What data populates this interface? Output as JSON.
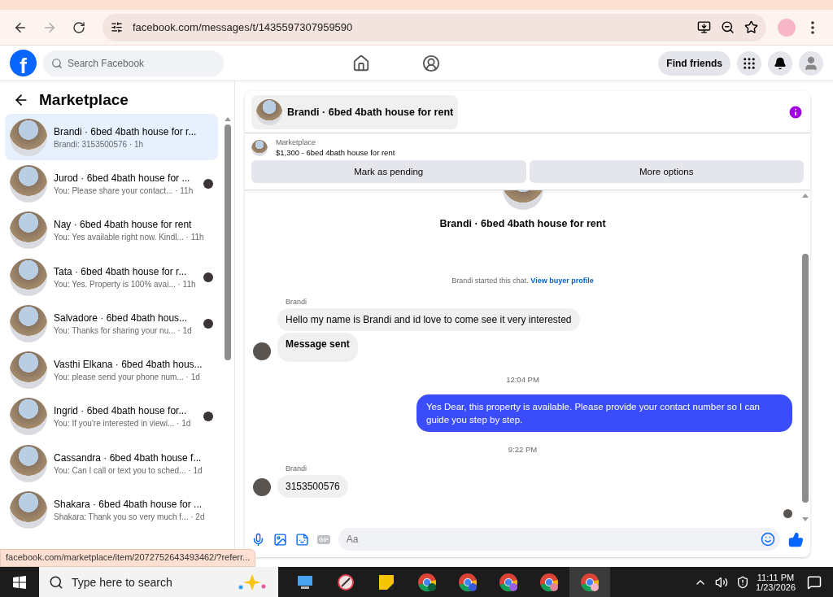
{
  "browser": {
    "url": "facebook.com/messages/t/1435597307959590"
  },
  "header": {
    "logo": "f",
    "search_placeholder": "Search Facebook",
    "find_friends": "Find friends"
  },
  "sidebar": {
    "title": "Marketplace",
    "conversations": [
      {
        "title": "Brandi · 6bed 4bath house for r...",
        "preview": "Brandi: 3153500576 · 1h",
        "selected": true,
        "seen_avatar": false
      },
      {
        "title": "Jurod · 6bed 4bath house for ...",
        "preview": "You: Please share your contact... · 11h",
        "selected": false,
        "seen_avatar": true
      },
      {
        "title": "Nay · 6bed 4bath house for rent",
        "preview": "You: Yes available right now. Kindl... · 11h",
        "selected": false,
        "seen_avatar": false
      },
      {
        "title": "Tata · 6bed 4bath house for r...",
        "preview": "You: Yes. Property is 100% avai... · 11h",
        "selected": false,
        "seen_avatar": true
      },
      {
        "title": "Salvadore · 6bed 4bath hous...",
        "preview": "You: Thanks for sharing your nu... · 1d",
        "selected": false,
        "seen_avatar": true
      },
      {
        "title": "Vasthi Elkana · 6bed 4bath hous...",
        "preview": "You: please send your phone num... · 1d",
        "selected": false,
        "seen_avatar": false
      },
      {
        "title": "Ingrid · 6bed 4bath house for...",
        "preview": "You: If you're interested in viewi... · 1d",
        "selected": false,
        "seen_avatar": true
      },
      {
        "title": "Cassandra · 6bed 4bath house f...",
        "preview": "You: Can I call or text you to sched... · 1d",
        "selected": false,
        "seen_avatar": false
      },
      {
        "title": "Shakara · 6bed 4bath house for ...",
        "preview": "Shakara: Thank you so very much f... · 2d",
        "selected": false,
        "seen_avatar": false
      }
    ]
  },
  "chat": {
    "title": "Brandi · 6bed 4bath house for rent",
    "listing_source": "Marketplace",
    "listing": "$1,300 - 6bed 4bath house for rent",
    "actions": [
      "Mark as pending",
      "More options"
    ],
    "messages": [
      {
        "kind": "intro",
        "text": "Brandi · 6bed 4bath house for rent"
      },
      {
        "kind": "notice",
        "text": "Brandi started this chat.",
        "link": "View buyer profile"
      },
      {
        "kind": "incoming",
        "sender": "Brandi",
        "bubbles": [
          {
            "text": "Hello my name is Brandi and id love to come  see it very interested",
            "bold": false
          },
          {
            "text": "Message sent",
            "bold": true
          }
        ]
      },
      {
        "kind": "time",
        "text": "12:04 PM"
      },
      {
        "kind": "outgoing",
        "text": "Yes Dear, this property is available. Please provide your contact number so I can guide you step by step."
      },
      {
        "kind": "time",
        "text": "9:22 PM"
      },
      {
        "kind": "incoming",
        "sender": "Brandi",
        "bubbles": [
          {
            "text": "3153500576",
            "bold": false
          }
        ]
      }
    ],
    "composer": {
      "gif": "GIF",
      "placeholder": "Aa"
    }
  },
  "status_url": "facebook.com/marketplace/item/2072752643493462/?referr...",
  "taskbar": {
    "search_placeholder": "Type here to search",
    "time": "11:11 PM",
    "date": "1/23/2026"
  }
}
